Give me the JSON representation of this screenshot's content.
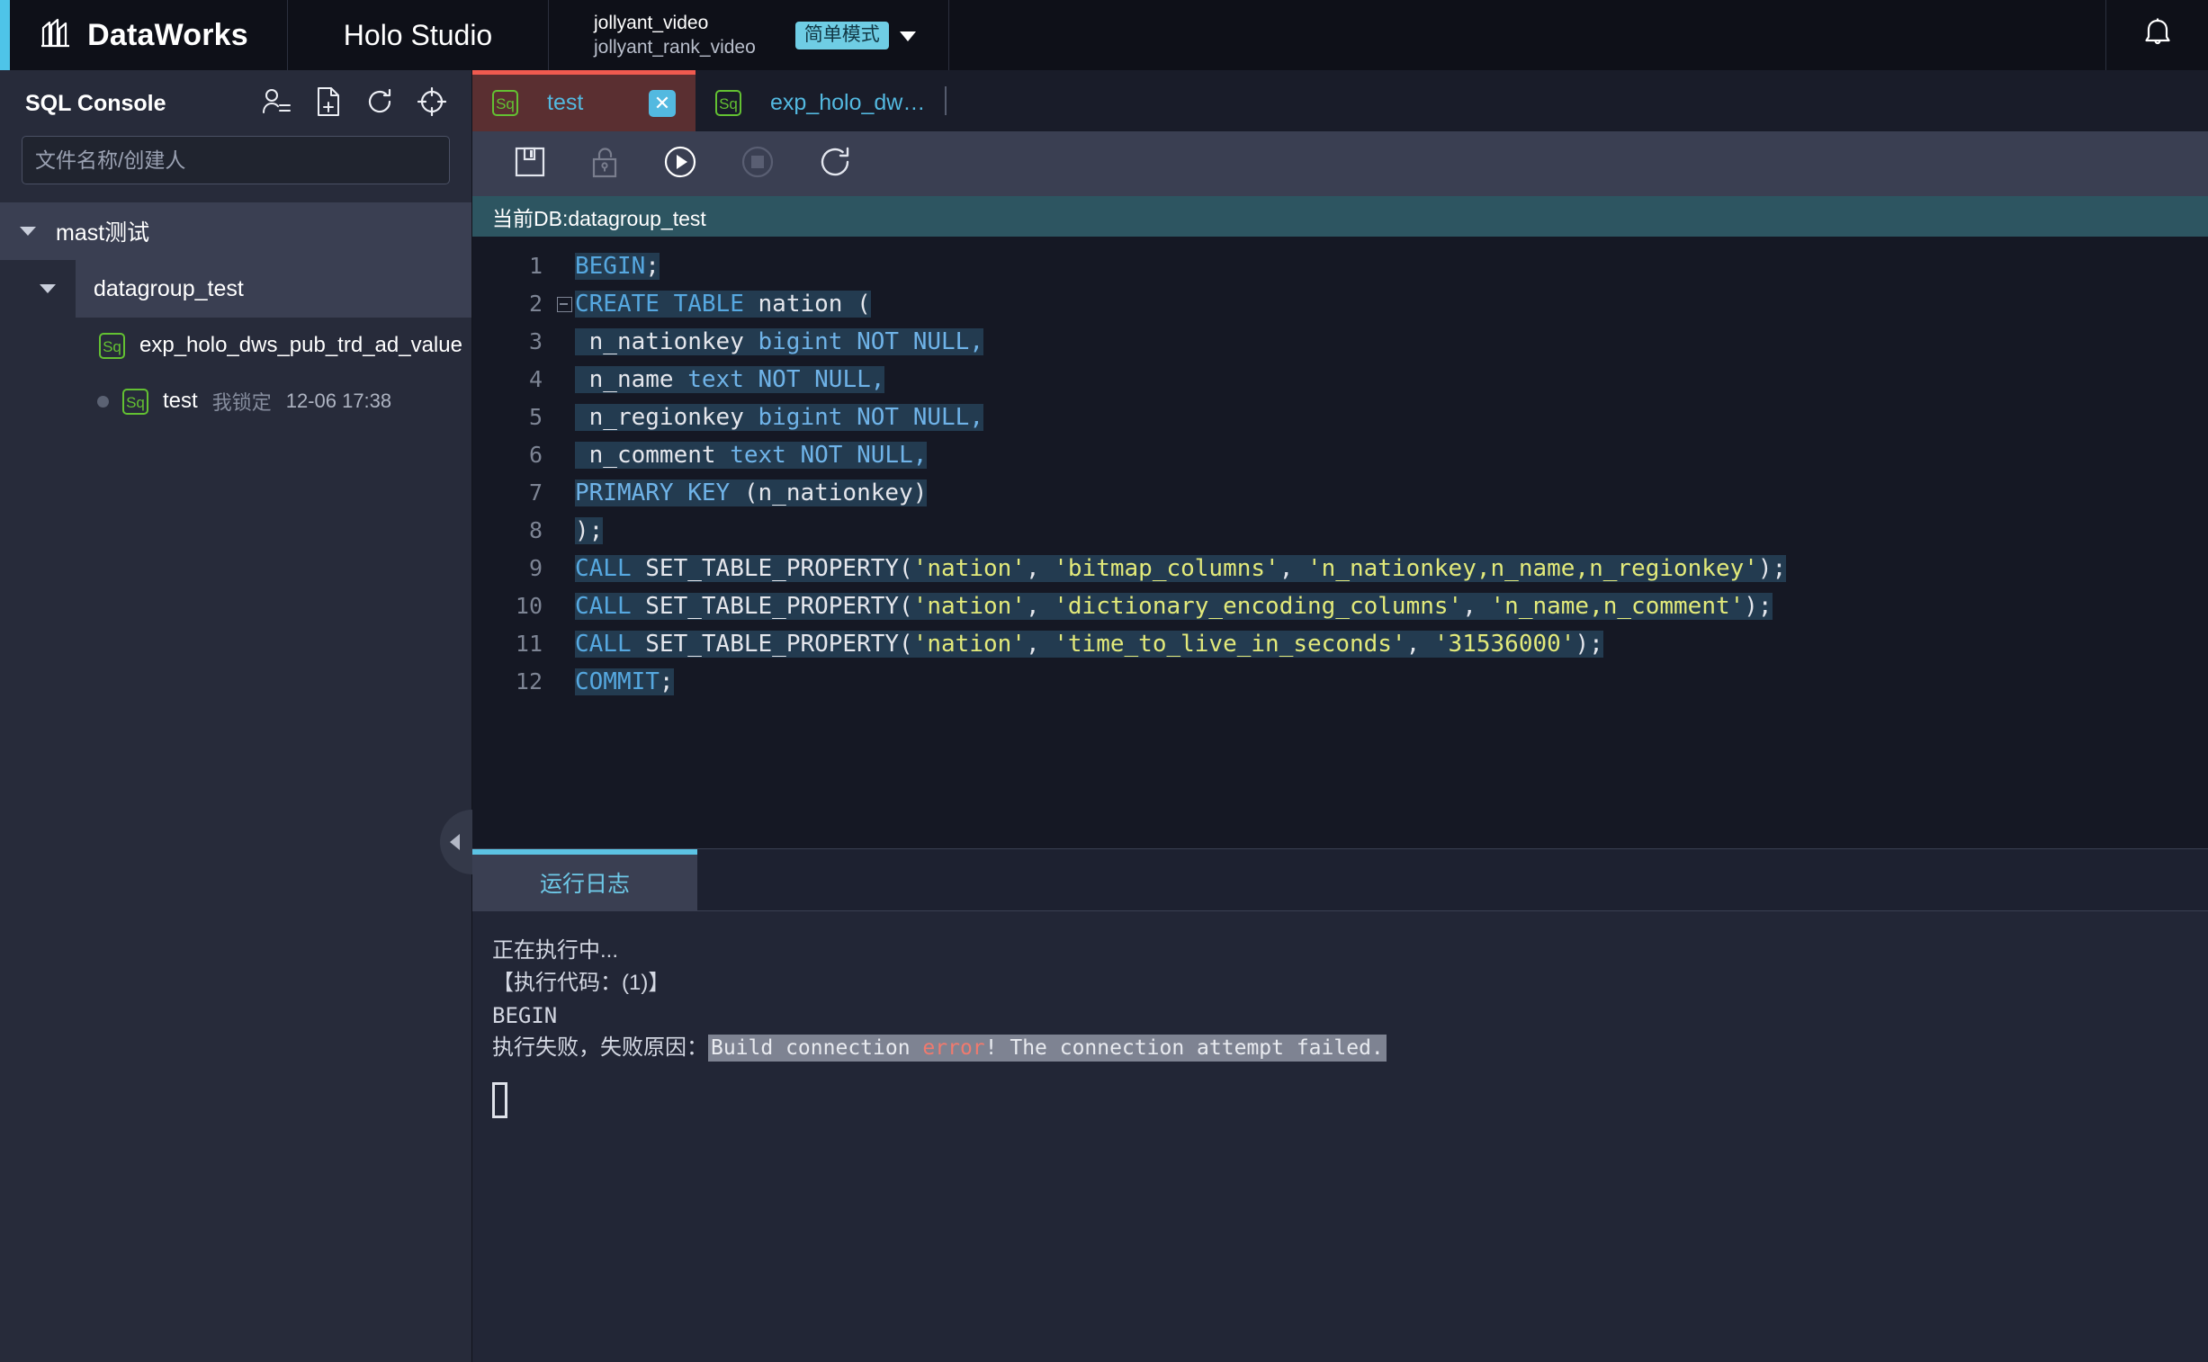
{
  "topbar": {
    "brand_name": "DataWorks",
    "brand_logo_icon": "dataworks-logo-icon",
    "product_name": "Holo Studio",
    "project_name": "jollyant_video",
    "project_sub": "jollyant_rank_video",
    "mode_badge": "简单模式",
    "mode_chevron_icon": "chevron-down-icon",
    "bell_icon": "notification-bell-icon",
    "accent_color": "#4ec4e8"
  },
  "sidebar": {
    "title": "SQL Console",
    "icons": [
      {
        "name": "user-list-icon",
        "title": "成员"
      },
      {
        "name": "new-file-icon",
        "title": "新建文件"
      },
      {
        "name": "refresh-icon",
        "title": "刷新"
      },
      {
        "name": "locate-icon",
        "title": "定位"
      }
    ],
    "search_placeholder": "文件名称/创建人",
    "search_value": "",
    "tree": {
      "root_label": "mast测试",
      "group_label": "datagroup_test",
      "files": [
        {
          "badge": "Sq",
          "name": "exp_holo_dws_pub_trd_ad_value",
          "lock": "",
          "time": ""
        },
        {
          "badge": "Sq",
          "name": "test",
          "lock": "我锁定",
          "time": "12-06 17:38"
        }
      ]
    },
    "collapse_icon": "chevron-left-icon"
  },
  "editor": {
    "tabs": [
      {
        "badge": "Sq",
        "label": "test",
        "active": true,
        "close_icon": "close-icon"
      },
      {
        "badge": "Sq",
        "label": "exp_holo_dw…",
        "active": false
      }
    ],
    "toolbar": [
      {
        "name": "save-button",
        "icon": "save-floppy-icon",
        "disabled": false
      },
      {
        "name": "unlock-button",
        "icon": "unlock-padlock-icon",
        "disabled": true
      },
      {
        "name": "run-button",
        "icon": "play-circle-icon",
        "disabled": false
      },
      {
        "name": "stop-button",
        "icon": "stop-circle-icon",
        "disabled": true
      },
      {
        "name": "refresh-button",
        "icon": "refresh-icon",
        "disabled": false
      }
    ],
    "db_bar": "当前DB:datagroup_test",
    "line_numbers": [
      "1",
      "2",
      "3",
      "4",
      "5",
      "6",
      "7",
      "8",
      "9",
      "10",
      "11",
      "12"
    ],
    "code_lines": [
      {
        "n": 1,
        "text": "BEGIN;"
      },
      {
        "n": 2,
        "text": "CREATE TABLE nation ("
      },
      {
        "n": 3,
        "text": "  n_nationkey bigint NOT NULL,"
      },
      {
        "n": 4,
        "text": "  n_name text NOT NULL,"
      },
      {
        "n": 5,
        "text": "  n_regionkey bigint NOT NULL,"
      },
      {
        "n": 6,
        "text": "  n_comment text NOT NULL,"
      },
      {
        "n": 7,
        "text": " PRIMARY KEY (n_nationkey)"
      },
      {
        "n": 8,
        "text": " );"
      },
      {
        "n": 9,
        "text": "CALL SET_TABLE_PROPERTY('nation', 'bitmap_columns', 'n_nationkey,n_name,n_regionkey');"
      },
      {
        "n": 10,
        "text": "CALL SET_TABLE_PROPERTY('nation', 'dictionary_encoding_columns', 'n_name,n_comment');"
      },
      {
        "n": 11,
        "text": "CALL SET_TABLE_PROPERTY('nation', 'time_to_live_in_seconds', '31536000');"
      },
      {
        "n": 12,
        "text": "COMMIT;"
      }
    ]
  },
  "log": {
    "tab_label": "运行日志",
    "lines": [
      {
        "text": "正在执行中..."
      },
      {
        "text": "【执行代码：(1)】"
      },
      {
        "text": "BEGIN"
      }
    ],
    "fail_prefix": "执行失败，失败原因：",
    "error_pre": "Build connection ",
    "error_word": "error",
    "error_post": "! The connection attempt failed.",
    "cursor_glyph": "tofu-box"
  }
}
